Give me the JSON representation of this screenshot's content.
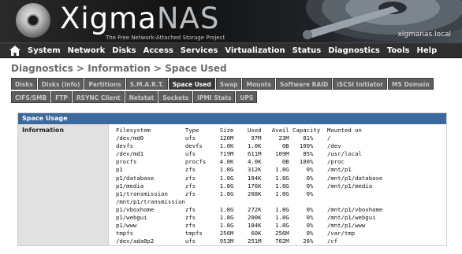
{
  "header": {
    "logo_part1": "Xigma",
    "logo_part2": "NAS",
    "tagline": "The Free Network-Attached Storage Project",
    "hostname": "xigmanas.local"
  },
  "nav": {
    "home_icon": "home-icon",
    "items": [
      "System",
      "Network",
      "Disks",
      "Access",
      "Services",
      "Virtualization",
      "Status",
      "Diagnostics",
      "Tools",
      "Help"
    ]
  },
  "breadcrumb": "Diagnostics > Information > Space Used",
  "tabs": {
    "row1": [
      "Disks",
      "Disks (Info)",
      "Partitions",
      "S.M.A.R.T.",
      "Space Used",
      "Swap",
      "Mounts",
      "Software RAID",
      "iSCSI Initiator",
      "MS Domain"
    ],
    "row2": [
      "CIFS/SMB",
      "FTP",
      "RSYNC Client",
      "Netstat",
      "Sockets",
      "IPMI Stats",
      "UPS"
    ],
    "active": "Space Used"
  },
  "panel": {
    "title": "Space Usage",
    "label": "Information",
    "df_output": "Filesystem          Type      Size    Used   Avail Capacity  Mounted on\n/dev/md0            ufs       120M     97M     23M    81%    /\ndevfs               devfs     1.0K    1.0K      0B   100%    /dev\n/dev/md1            ufs       719M    611M    109M    85%    /usr/local\nprocfs              procfs    4.0K    4.0K      0B   100%    /proc\np1                  zfs       1.8G    312K    1.8G     0%    /mnt/p1\np1/database         zfs       1.8G    184K    1.8G     0%    /mnt/p1/database\np1/media            zfs       1.8G    176K    1.8G     0%    /mnt/p1/media\np1/transmission     zfs       1.8G    208K    1.8G     0%\n/mnt/p1/transmission\np1/vboxhome         zfs       1.8G    272K    1.8G     0%    /mnt/p1/vboxhome\np1/webgui           zfs       1.8G    200K    1.8G     0%    /mnt/p1/webgui\np1/www              zfs       1.8G    184K    1.8G     0%    /mnt/p1/www\ntmpfs               tmpfs     256M     60K    256M     0%    /var/tmp\n/dev/ada0p2         ufs       953M    251M    702M    26%    /cf"
  },
  "colors": {
    "header_bg": "#1c1c1c",
    "nav_bg": "#2f2f2f",
    "panel_title_bg": "#3d6a9e",
    "tab_bg": "#5e5e5e",
    "tab_active_bg": "#3a3a3a"
  }
}
